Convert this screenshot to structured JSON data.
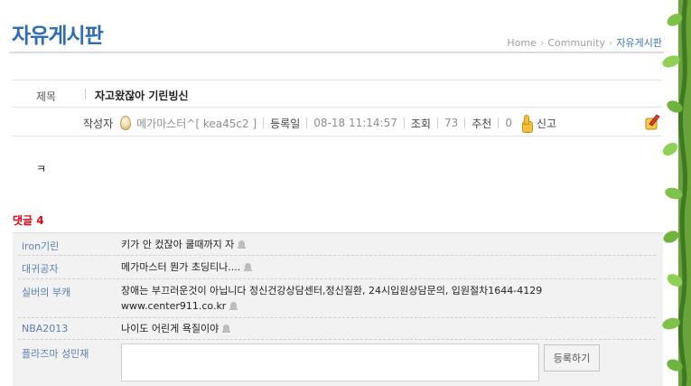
{
  "board": {
    "title": "자유게시판"
  },
  "breadcrumb": {
    "home": "Home",
    "section": "Community",
    "current": "자유게시판"
  },
  "post": {
    "subject_label": "제목",
    "subject": "자고왔잖아 기린빙신",
    "author_label": "작성자",
    "author": "메가마스터^[ kea45c2 ]",
    "date_label": "등록일",
    "date": "08-18 11:14:57",
    "views_label": "조회",
    "views": "73",
    "recommend_label": "추천",
    "recommend": "0",
    "report_label": "신고",
    "body": "ㅋ"
  },
  "comments": {
    "heading": "댓글",
    "count": "4",
    "items": [
      {
        "name": "iron기린",
        "text": "키가 안 컸잖아 쿨때까지 자"
      },
      {
        "name": "대귀공자",
        "text": "메가마스터 뭔가 초딩티나...."
      },
      {
        "name": "실버의 부캐",
        "text": "장애는 부끄러운것이 아닙니다 정신건강상담센터,정신질환, 24시입원상담문의, 입원절차1644-4129",
        "text2": "www.center911.co.kr"
      },
      {
        "name": "NBA2013",
        "text": "나이도 어린게 욕질이야"
      }
    ],
    "write_name": "플라즈마 성민재",
    "input_value": "",
    "submit_label": "등록하기"
  },
  "icons": {
    "author_icon": "egg-icon",
    "recommend_icon": "thumbs-up-icon",
    "report_icon": "report-pencil-icon",
    "comment_icon": "bell-icon"
  },
  "colors": {
    "title_blue": "#2e6cb5",
    "comment_heading_red": "#e60012",
    "comment_name_blue": "#5b7fb0"
  }
}
